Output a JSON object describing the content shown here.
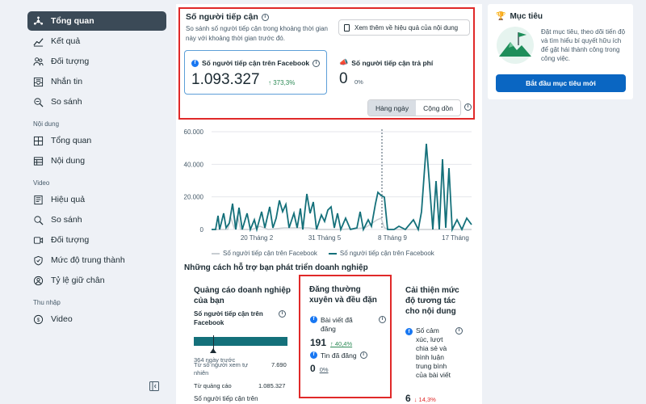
{
  "sidebar": {
    "items": [
      {
        "label": "Tổng quan",
        "icon": "overview-icon",
        "active": true
      },
      {
        "label": "Kết quả",
        "icon": "results-icon"
      },
      {
        "label": "Đối tượng",
        "icon": "audience-icon"
      },
      {
        "label": "Nhắn tin",
        "icon": "messages-icon"
      },
      {
        "label": "So sánh",
        "icon": "compare-icon"
      }
    ],
    "content_section": "Nội dung",
    "content_items": [
      {
        "label": "Tổng quan",
        "icon": "grid-icon"
      },
      {
        "label": "Nội dung",
        "icon": "table-icon"
      }
    ],
    "video_section": "Video",
    "video_items": [
      {
        "label": "Hiệu quả",
        "icon": "performance-icon"
      },
      {
        "label": "So sánh",
        "icon": "compare-icon"
      },
      {
        "label": "Đối tượng",
        "icon": "video-audience-icon"
      },
      {
        "label": "Mức độ trung thành",
        "icon": "loyalty-icon"
      },
      {
        "label": "Tỷ lệ giữ chân",
        "icon": "retention-icon"
      }
    ],
    "income_section": "Thu nhập",
    "income_items": [
      {
        "label": "Video",
        "icon": "dollar-icon"
      }
    ]
  },
  "reach": {
    "title": "Số người tiếp cận",
    "description": "So sánh số người tiếp cận trong khoảng thời gian này với khoảng thời gian trước đó.",
    "see_more": "Xem thêm về hiệu quả của nội dung",
    "facebook_label": "Số người tiếp cận trên Facebook",
    "facebook_value": "1.093.327",
    "facebook_change": "↑ 373,3%",
    "paid_label": "Số người tiếp cận trả phí",
    "paid_value": "0",
    "paid_change": "0%",
    "toggle_daily": "Hàng ngày",
    "toggle_cumulative": "Cộng dồn"
  },
  "chart_data": {
    "type": "line",
    "y_ticks": [
      "60.000",
      "40.000",
      "20.000",
      "0"
    ],
    "x_ticks": [
      "20 Tháng 2",
      "31 Tháng 5",
      "8 Tháng 9",
      "17 Tháng"
    ],
    "ylim": [
      0,
      60000
    ],
    "series": [
      {
        "name": "Số người tiếp cận trên Facebook",
        "color": "#c8cdd2"
      },
      {
        "name": "Số người tiếp cận trên Facebook",
        "color": "#14707a"
      }
    ]
  },
  "help": {
    "section_title": "Những cách hỗ trợ bạn phát triển doanh nghiệp",
    "ads_card": {
      "title": "Quảng cáo doanh nghiệp của bạn",
      "metric_label": "Số người tiếp cận trên Facebook",
      "marker_label": "364 ngày trước",
      "row1_label": "Từ số người xem tự nhiên",
      "row1_value": "7.690",
      "row2_label": "Từ quảng cáo",
      "row2_value": "1.085.327",
      "footer": "Số người tiếp cận trên"
    },
    "post_card": {
      "title": "Đăng thường xuyên và đều đặn",
      "posts_label": "Bài viết đã đăng",
      "posts_value": "191",
      "posts_change": "↑ 40,4%",
      "stories_label": "Tin đã đăng",
      "stories_value": "0",
      "stories_change": "0%"
    },
    "engage_card": {
      "title": "Cải thiện mức độ tương tác cho nội dung",
      "metric_label": "Số cảm xúc, lượt chia sẻ và bình luận trung bình của bài viết",
      "value": "6",
      "change": "↓ 14,3%"
    }
  },
  "goal": {
    "title": "Mục tiêu",
    "text": "Đặt mục tiêu, theo dõi tiến độ và tìm hiểu bí quyết hữu ích để gặt hái thành công trong công việc.",
    "button": "Bắt đầu mục tiêu mới"
  }
}
